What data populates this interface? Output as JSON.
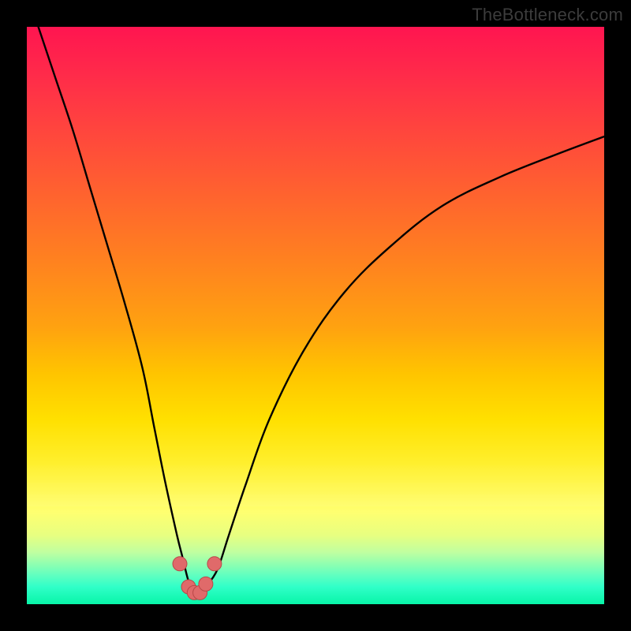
{
  "watermark": "TheBottleneck.com",
  "colors": {
    "frame": "#000000",
    "curve_stroke": "#000000",
    "marker_fill": "#e06a6a",
    "marker_stroke": "#b84848"
  },
  "chart_data": {
    "type": "line",
    "title": "",
    "xlabel": "",
    "ylabel": "",
    "xlim": [
      0,
      100
    ],
    "ylim": [
      0,
      100
    ],
    "grid": false,
    "legend": false,
    "series": [
      {
        "name": "bottleneck-curve",
        "x": [
          2,
          5,
          8,
          11,
          14,
          17,
          20,
          22,
          24,
          26,
          27,
          28,
          29,
          30,
          31,
          33,
          35,
          38,
          42,
          48,
          55,
          63,
          72,
          82,
          92,
          100
        ],
        "values": [
          100,
          91,
          82,
          72,
          62,
          52,
          41,
          31,
          21,
          12,
          8,
          4,
          2,
          2,
          3,
          6,
          12,
          21,
          32,
          44,
          54,
          62,
          69,
          74,
          78,
          81
        ]
      }
    ],
    "markers": {
      "name": "trough-markers",
      "x": [
        26.5,
        28.0,
        29.0,
        30.0,
        31.0,
        32.5
      ],
      "values": [
        7.0,
        3.0,
        2.0,
        2.0,
        3.5,
        7.0
      ]
    }
  }
}
